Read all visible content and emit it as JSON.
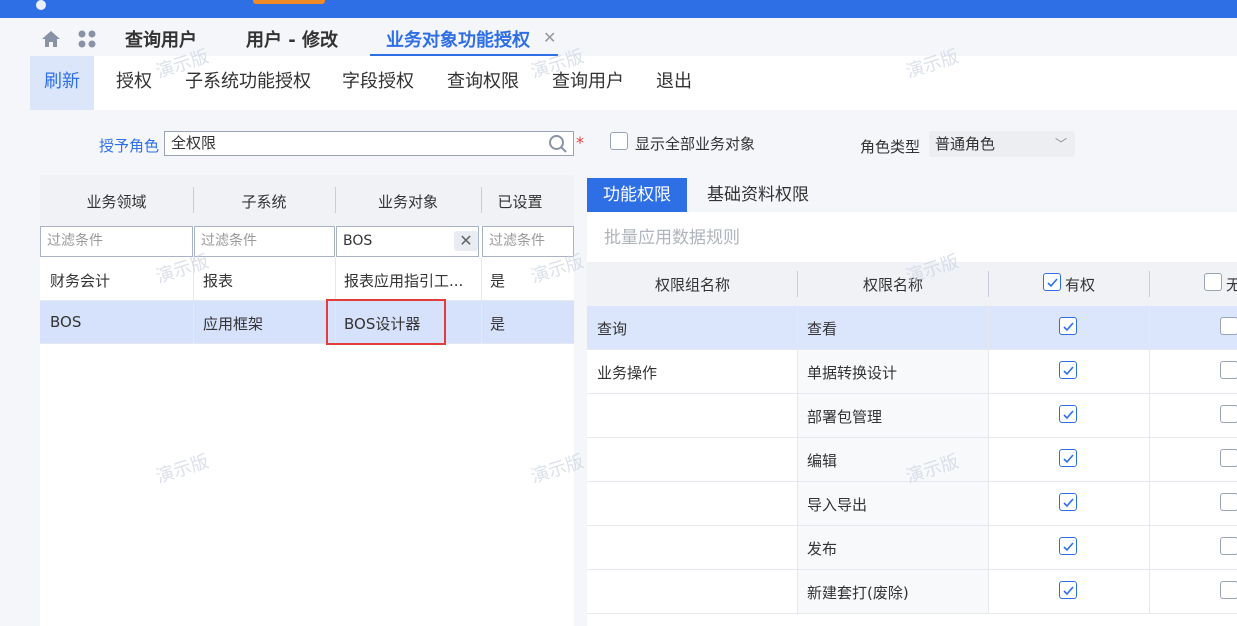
{
  "tabs": {
    "items": [
      {
        "label": "查询用户"
      },
      {
        "label": "用户 - 修改"
      },
      {
        "label": "业务对象功能授权"
      }
    ]
  },
  "toolbar": {
    "items": [
      {
        "label": "刷新"
      },
      {
        "label": "授权"
      },
      {
        "label": "子系统功能授权"
      },
      {
        "label": "字段授权"
      },
      {
        "label": "查询权限"
      },
      {
        "label": "查询用户"
      },
      {
        "label": "退出"
      }
    ]
  },
  "filter": {
    "role_label": "授予角色",
    "role_value": "全权限",
    "show_all_label": "显示全部业务对象",
    "role_type_label": "角色类型",
    "role_type_value": "普通角色"
  },
  "left_table": {
    "headers": [
      "业务领域",
      "子系统",
      "业务对象",
      "已设置"
    ],
    "filter_placeholder": "过滤条件",
    "filter_value_object": "BOS",
    "rows": [
      [
        "财务会计",
        "报表",
        "报表应用指引工...",
        "是"
      ],
      [
        "BOS",
        "应用框架",
        "BOS设计器",
        "是"
      ]
    ]
  },
  "right_panel": {
    "tabs": [
      {
        "label": "功能权限"
      },
      {
        "label": "基础资料权限"
      }
    ],
    "batch_label": "批量应用数据规则",
    "headers": [
      "权限组名称",
      "权限名称",
      "有权",
      "无"
    ],
    "rows": [
      {
        "group": "查询",
        "name": "查看"
      },
      {
        "group": "业务操作",
        "name": "单据转换设计"
      },
      {
        "group": "",
        "name": "部署包管理"
      },
      {
        "group": "",
        "name": "编辑"
      },
      {
        "group": "",
        "name": "导入导出"
      },
      {
        "group": "",
        "name": "发布"
      },
      {
        "group": "",
        "name": "新建套打(废除)"
      }
    ]
  },
  "watermark": "演示版",
  "colors": {
    "accent": "#2f6fe6",
    "selection": "#d6e2fb",
    "highlight_box": "#e23c3c",
    "brand_orange": "#f08a24"
  }
}
